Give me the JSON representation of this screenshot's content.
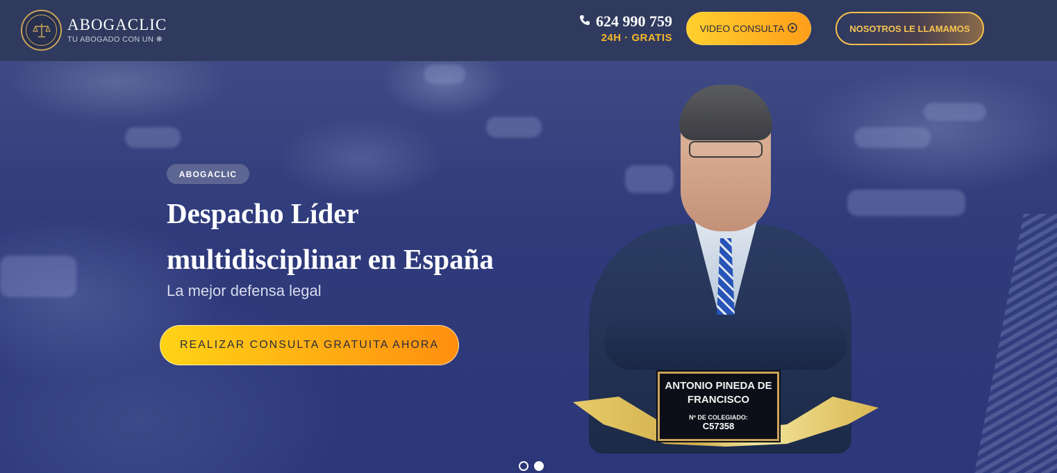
{
  "header": {
    "brand": "ABOGACLIC",
    "tagline": "TU ABOGADO CON UN",
    "phone_number": "624 990 759",
    "phone_sub": "24H · GRATIS",
    "video_button": "VIDEO CONSULTA",
    "call_button": "NOSOTROS LE LLAMAMOS"
  },
  "hero": {
    "badge": "ABOGACLIC",
    "title": "Despacho Líder multidisciplinar en España",
    "subtitle": "La mejor defensa legal",
    "cta": "REALIZAR CONSULTA GRATUITA AHORA"
  },
  "plate": {
    "name": "ANTONIO PINEDA DE FRANCISCO",
    "label": "Nº DE COLEGIADO:",
    "number": "C57358"
  },
  "carousel": {
    "slides": 2,
    "active_index": 1
  },
  "icons": {
    "phone": "phone-icon",
    "video": "play-circle-icon",
    "logo": "scales-seal-icon",
    "tagline_glyph": "sparkle-icon"
  },
  "colors": {
    "header_bg": "#2f3a5e",
    "accent_gold": "#f5b82c",
    "cta_gradient_start": "#ffd316",
    "cta_gradient_end": "#ff8f0f",
    "hero_bg": "#2f3b7b"
  }
}
